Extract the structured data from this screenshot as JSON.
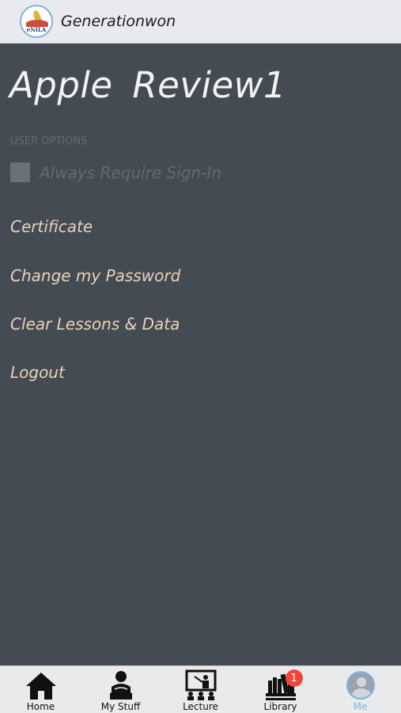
{
  "header": {
    "app_title": "Generationwon",
    "logo_text": "eNILA"
  },
  "profile": {
    "username": "Apple  Review1"
  },
  "user_options": {
    "section_label": "USER OPTIONS",
    "always_require_signin_label": "Always Require Sign-In",
    "always_require_signin_checked": false
  },
  "menu": {
    "items": [
      {
        "label": "Certificate"
      },
      {
        "label": "Change my Password"
      },
      {
        "label": "Clear Lessons & Data"
      },
      {
        "label": "Logout"
      }
    ]
  },
  "tabbar": {
    "tabs": [
      {
        "label": "Home",
        "icon": "home-icon"
      },
      {
        "label": "My Stuff",
        "icon": "reader-icon"
      },
      {
        "label": "Lecture",
        "icon": "lecture-icon"
      },
      {
        "label": "Library",
        "icon": "library-icon",
        "badge": "1"
      },
      {
        "label": "Me",
        "icon": "avatar-icon",
        "active": true
      }
    ]
  },
  "colors": {
    "background": "#454b53",
    "header_bg": "#e8eaed",
    "menu_text": "#e6d3b9",
    "active_tab": "#7cb4e0",
    "badge": "#f0473a"
  }
}
